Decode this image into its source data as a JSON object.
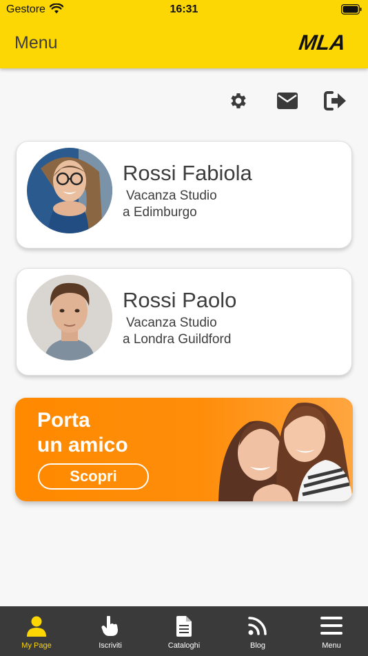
{
  "status_bar": {
    "carrier": "Gestore",
    "time": "16:31"
  },
  "header": {
    "title": "Menu",
    "logo": "MLA"
  },
  "toolbar": {
    "icons": [
      "gear-icon",
      "mail-icon",
      "logout-icon"
    ]
  },
  "students": [
    {
      "name": "Rossi Fabiola",
      "trip_line1": "Vacanza Studio",
      "trip_line2": "a Edimburgo"
    },
    {
      "name": "Rossi Paolo",
      "trip_line1": "Vacanza Studio",
      "trip_line2": "a Londra Guildford"
    }
  ],
  "promo": {
    "line1": "Porta",
    "line2": "un amico",
    "button": "Scopri"
  },
  "tabbar": {
    "items": [
      {
        "label": "My Page",
        "icon": "person-icon",
        "active": true
      },
      {
        "label": "Iscriviti",
        "icon": "hand-pointer-icon",
        "active": false
      },
      {
        "label": "Cataloghi",
        "icon": "document-icon",
        "active": false
      },
      {
        "label": "Blog",
        "icon": "rss-icon",
        "active": false
      },
      {
        "label": "Menu",
        "icon": "hamburger-icon",
        "active": false
      }
    ]
  },
  "colors": {
    "brand_yellow": "#fdd704",
    "promo_orange": "#ff8a00",
    "tabbar_bg": "#3a3a3a",
    "text_dark": "#3d3d3d"
  }
}
